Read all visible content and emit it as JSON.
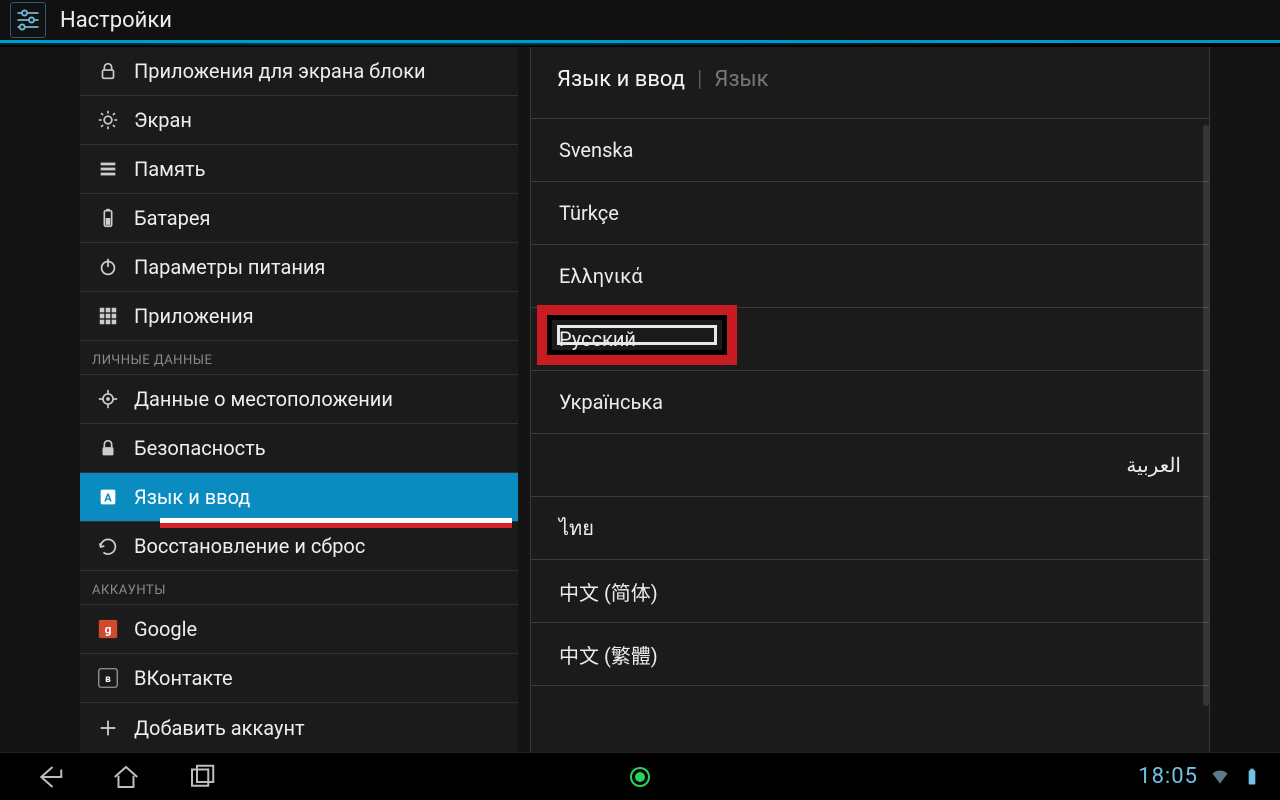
{
  "title": "Настройки",
  "sidebar": {
    "items": [
      {
        "label": "Приложения для экрана блоки",
        "icon": "lock"
      },
      {
        "label": "Экран",
        "icon": "brightness"
      },
      {
        "label": "Память",
        "icon": "storage"
      },
      {
        "label": "Батарея",
        "icon": "battery"
      },
      {
        "label": "Параметры питания",
        "icon": "power"
      },
      {
        "label": "Приложения",
        "icon": "apps"
      }
    ],
    "personal_header": "ЛИЧНЫЕ ДАННЫЕ",
    "personal": [
      {
        "label": "Данные о местоположении",
        "icon": "location"
      },
      {
        "label": "Безопасность",
        "icon": "security"
      },
      {
        "label": "Язык и ввод",
        "icon": "language",
        "active": true
      },
      {
        "label": "Восстановление и сброс",
        "icon": "backup"
      }
    ],
    "accounts_header": "АККАУНТЫ",
    "accounts": [
      {
        "label": "Google",
        "icon": "google"
      },
      {
        "label": "ВКонтакте",
        "icon": "vk"
      },
      {
        "label": "Добавить аккаунт",
        "icon": "plus"
      }
    ]
  },
  "breadcrumb": {
    "main": "Язык и ввод",
    "sub": "Язык",
    "sep": "|"
  },
  "languages": [
    {
      "label": "Svenska"
    },
    {
      "label": "Türkçe"
    },
    {
      "label": "Ελληνικά"
    },
    {
      "label": "Русский",
      "highlighted": true
    },
    {
      "label": "Українська"
    },
    {
      "label": "العربية",
      "rtl": true
    },
    {
      "label": "ไทย"
    },
    {
      "label": "中文 (简体)"
    },
    {
      "label": "中文 (繁體)"
    }
  ],
  "statusbar": {
    "time": "18:05"
  },
  "colors": {
    "accent": "#0099cc",
    "highlight_red": "#c81b22",
    "active": "#0b8cc1"
  }
}
